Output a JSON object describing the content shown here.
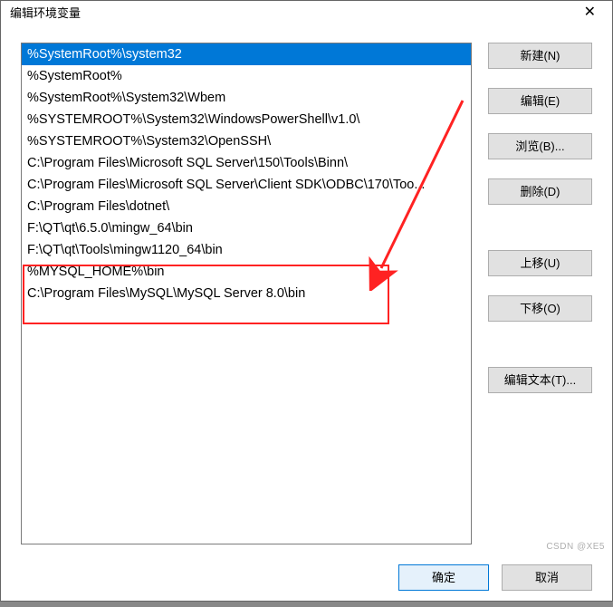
{
  "title": "编辑环境变量",
  "list": {
    "items": [
      "%SystemRoot%\\system32",
      "%SystemRoot%",
      "%SystemRoot%\\System32\\Wbem",
      "%SYSTEMROOT%\\System32\\WindowsPowerShell\\v1.0\\",
      "%SYSTEMROOT%\\System32\\OpenSSH\\",
      "C:\\Program Files\\Microsoft SQL Server\\150\\Tools\\Binn\\",
      "C:\\Program Files\\Microsoft SQL Server\\Client SDK\\ODBC\\170\\Too...",
      "C:\\Program Files\\dotnet\\",
      "F:\\QT\\qt\\6.5.0\\mingw_64\\bin",
      "F:\\QT\\qt\\Tools\\mingw1120_64\\bin",
      "%MYSQL_HOME%\\bin",
      "C:\\Program Files\\MySQL\\MySQL Server 8.0\\bin"
    ],
    "selected_index": 0,
    "highlighted_range": [
      10,
      11
    ]
  },
  "buttons": {
    "new": "新建(N)",
    "edit": "编辑(E)",
    "browse": "浏览(B)...",
    "delete": "删除(D)",
    "move_up": "上移(U)",
    "move_down": "下移(O)",
    "edit_text": "编辑文本(T)...",
    "ok": "确定",
    "cancel": "取消"
  },
  "watermark": "CSDN @XE5"
}
